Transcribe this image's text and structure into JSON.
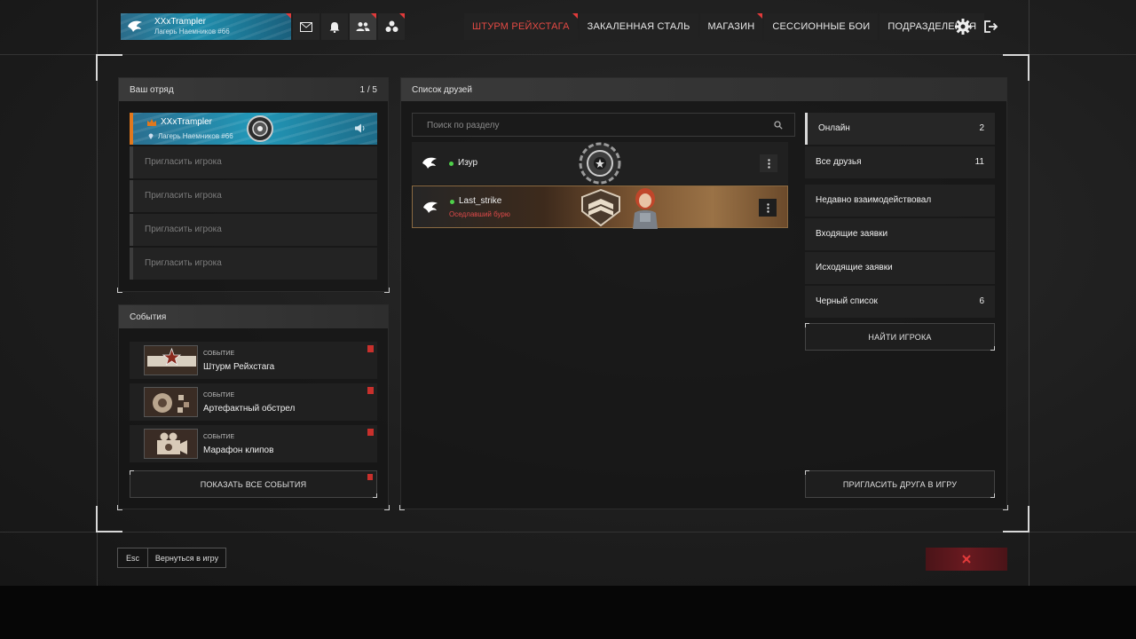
{
  "player": {
    "name": "XXxTrampler",
    "subtitle": "Лагерь Наемников #66"
  },
  "top_icons": [
    "mail-icon",
    "bell-icon",
    "friends-icon",
    "squad-icon"
  ],
  "nav": {
    "items": [
      {
        "label": "ШТУРМ РЕЙХСТАГА",
        "highlight": true,
        "badge": true
      },
      {
        "label": "ЗАКАЛЕННАЯ СТАЛЬ",
        "highlight": false,
        "badge": false
      },
      {
        "label": "МАГАЗИН",
        "highlight": false,
        "badge": true
      },
      {
        "label": "СЕССИОННЫЕ БОИ",
        "highlight": false,
        "badge": false
      },
      {
        "label": "ПОДРАЗДЕЛЕНИЯ",
        "highlight": false,
        "badge": false
      }
    ],
    "settings_icon": "gear-icon",
    "exit_icon": "logout-icon"
  },
  "squad": {
    "title": "Ваш отряд",
    "count": "1 / 5",
    "leader": {
      "name": "XXxTrampler",
      "subtitle": "Лагерь Наемников #66"
    },
    "invite_label": "Пригласить игрока"
  },
  "events": {
    "title": "События",
    "items": [
      {
        "tag": "СОБЫТИЕ",
        "title": "Штурм Рейхстага"
      },
      {
        "tag": "СОБЫТИЕ",
        "title": "Артефактный обстрел"
      },
      {
        "tag": "СОБЫТИЕ",
        "title": "Марафон клипов"
      }
    ],
    "show_all": "ПОКАЗАТЬ ВСЕ СОБЫТИЯ"
  },
  "friends": {
    "title": "Список друзей",
    "search_placeholder": "Поиск по разделу",
    "list": [
      {
        "name": "Изур",
        "status": ""
      },
      {
        "name": "Last_strike",
        "status": "Оседлавший бурю"
      }
    ]
  },
  "filters": [
    {
      "label": "Онлайн",
      "count": "2"
    },
    {
      "label": "Все друзья",
      "count": "11"
    },
    {
      "label": "Недавно взаимодействовал",
      "count": ""
    },
    {
      "label": "Входящие заявки",
      "count": ""
    },
    {
      "label": "Исходящие заявки",
      "count": ""
    },
    {
      "label": "Черный список",
      "count": "6"
    }
  ],
  "find_player": "НАЙТИ ИГРОКА",
  "invite_friend": "ПРИГЛАСИТЬ ДРУГА В ИГРУ",
  "footer": {
    "esc": "Esc",
    "back": "Вернуться в игру"
  },
  "colors": {
    "accent_red": "#e44a44",
    "online_green": "#4fd14a",
    "leader_orange": "#e0781e"
  }
}
